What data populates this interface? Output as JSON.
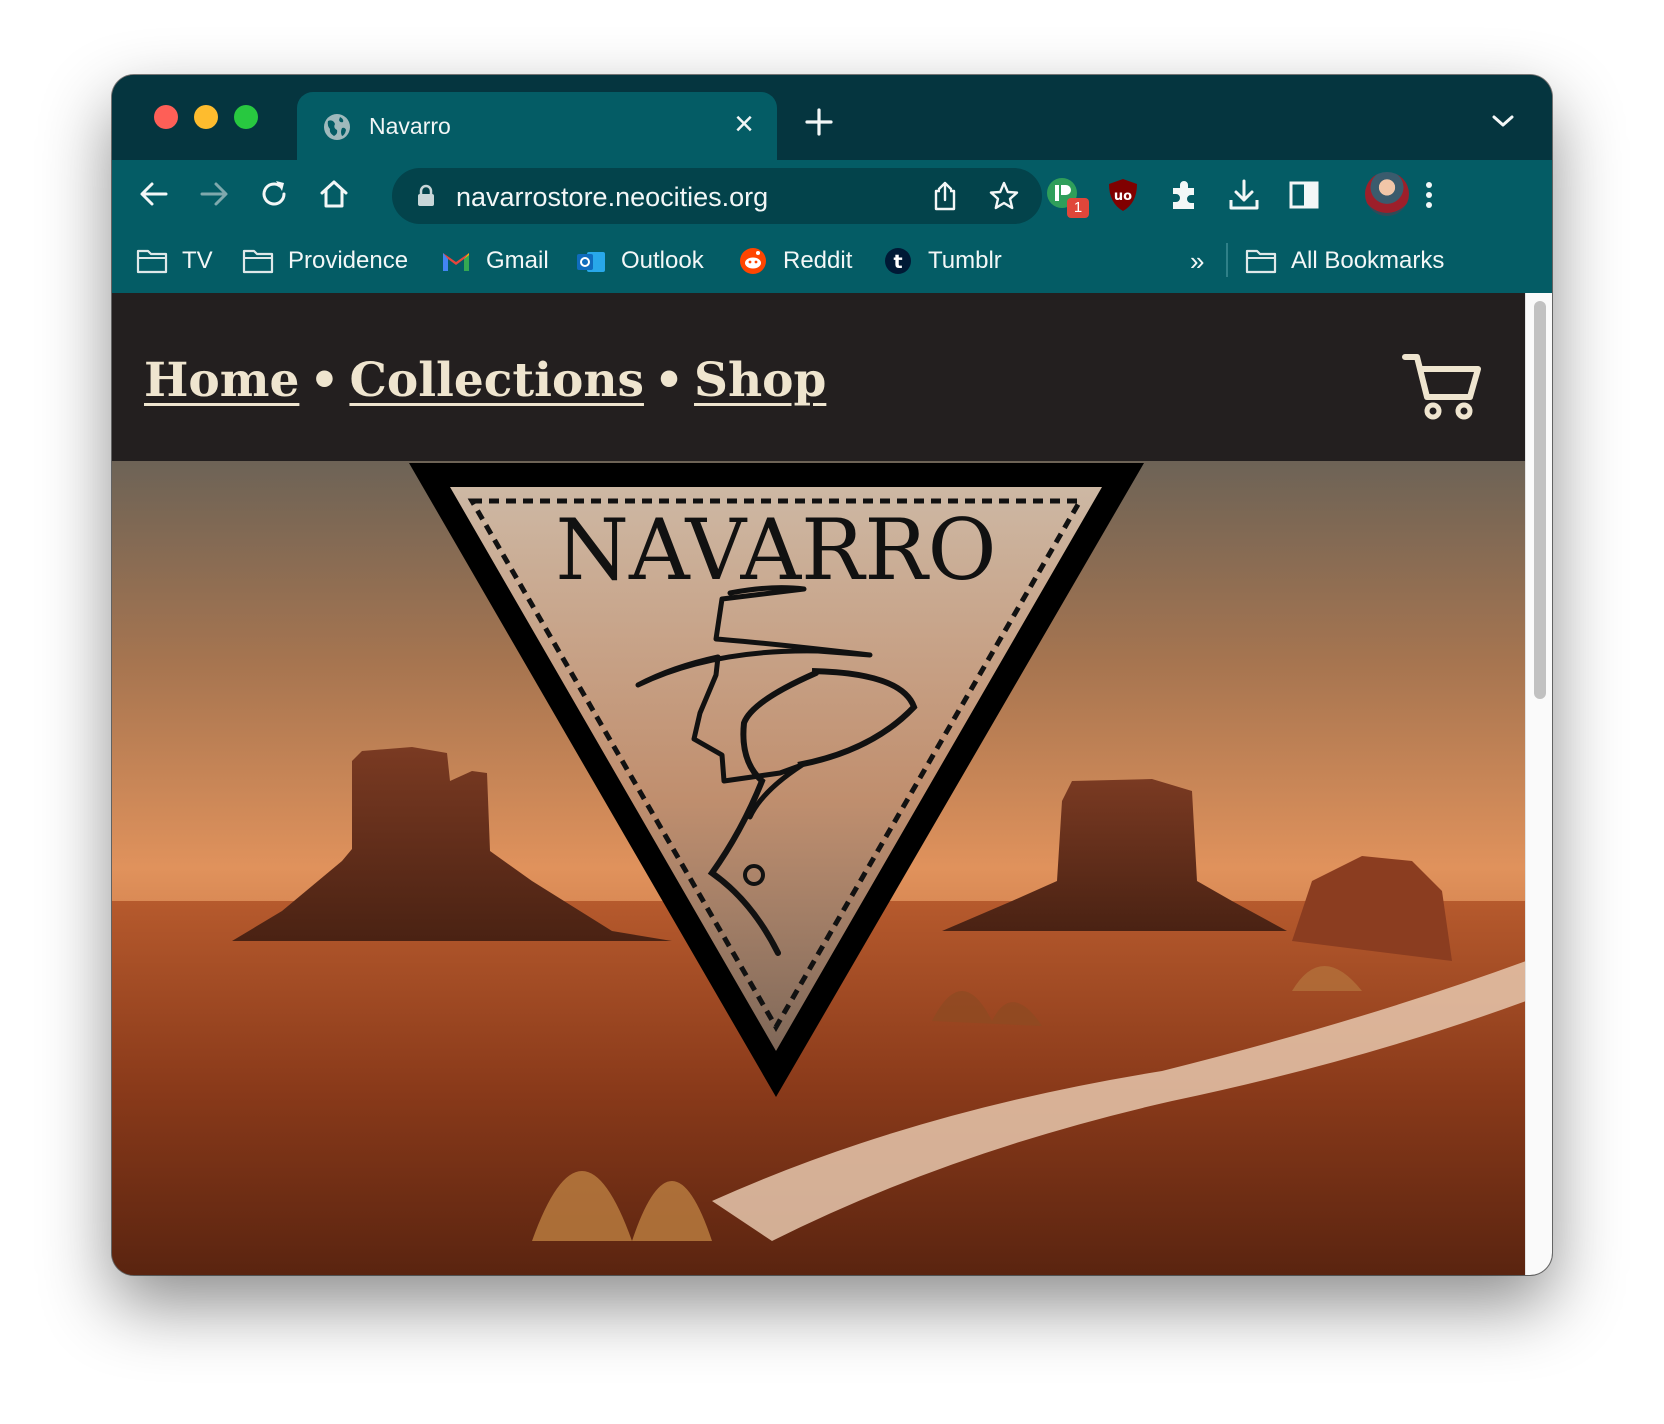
{
  "tab": {
    "title": "Navarro",
    "close_label": "×"
  },
  "omnibox": {
    "url": "navarrostore.neocities.org"
  },
  "extensions": {
    "badge_count": "1"
  },
  "bookmarks": {
    "items": [
      {
        "label": "TV",
        "icon": "folder-icon"
      },
      {
        "label": "Providence",
        "icon": "folder-icon"
      },
      {
        "label": "Gmail",
        "icon": "gmail-icon"
      },
      {
        "label": "Outlook",
        "icon": "outlook-icon"
      },
      {
        "label": "Reddit",
        "icon": "reddit-icon"
      },
      {
        "label": "Tumblr",
        "icon": "tumblr-icon"
      }
    ],
    "more": "»",
    "all_bookmarks": "All Bookmarks"
  },
  "site": {
    "nav": {
      "home": "Home",
      "collections": "Collections",
      "shop": "Shop",
      "separator": "•"
    },
    "logo_text": "NAVARRO"
  },
  "colors": {
    "tabstrip": "#05353f",
    "toolbar": "#045c65",
    "nav_background": "#231f1f",
    "nav_text": "#efe5cf"
  }
}
